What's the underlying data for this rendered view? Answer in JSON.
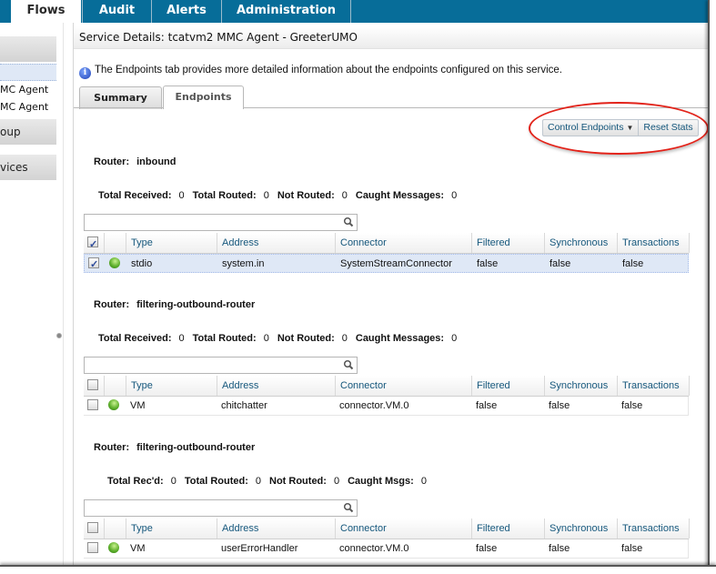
{
  "top_nav": {
    "tabs": [
      {
        "label": "Flows",
        "active": true
      },
      {
        "label": "Audit",
        "active": false
      },
      {
        "label": "Alerts",
        "active": false
      },
      {
        "label": "Administration",
        "active": false
      }
    ],
    "brand_color": "#076d99"
  },
  "sidebar": {
    "items": [
      {
        "label": "",
        "kind": "header"
      },
      {
        "label": "",
        "kind": "selected"
      },
      {
        "label": "MC Agent",
        "kind": "item"
      },
      {
        "label": "MC Agent",
        "kind": "item"
      },
      {
        "label": "oup",
        "kind": "header"
      },
      {
        "label": "vices",
        "kind": "header"
      }
    ]
  },
  "main": {
    "title": "Service Details: tcatvm2 MMC Agent - GreeterUMO",
    "info_text": "The Endpoints tab provides more detailed information about the endpoints configured on this service.",
    "tabs": [
      {
        "label": "Summary",
        "active": false
      },
      {
        "label": "Endpoints",
        "active": true
      }
    ],
    "actions": {
      "control_endpoints": "Control Endpoints",
      "reset_stats": "Reset Stats"
    },
    "annotation_color": "#e2231a",
    "columns": [
      "Type",
      "Address",
      "Connector",
      "Filtered",
      "Synchronous",
      "Transactions"
    ],
    "routers": [
      {
        "label": "Router:",
        "name": "inbound",
        "stats": [
          {
            "label": "Total Received:",
            "value": "0"
          },
          {
            "label": "Total Routed:",
            "value": "0"
          },
          {
            "label": "Not Routed:",
            "value": "0"
          },
          {
            "label": "Caught Messages:",
            "value": "0"
          }
        ],
        "search_value": "",
        "header_checked": true,
        "rows": [
          {
            "checked": true,
            "selected": true,
            "status": "running",
            "type": "stdio",
            "address": "system.in",
            "connector": "SystemStreamConnector",
            "filtered": "false",
            "synchronous": "false",
            "transactions": "false"
          }
        ]
      },
      {
        "label": "Router:",
        "name": "filtering-outbound-router",
        "stats": [
          {
            "label": "Total Received:",
            "value": "0"
          },
          {
            "label": "Total Routed:",
            "value": "0"
          },
          {
            "label": "Not Routed:",
            "value": "0"
          },
          {
            "label": "Caught Messages:",
            "value": "0"
          }
        ],
        "search_value": "",
        "header_checked": false,
        "rows": [
          {
            "checked": false,
            "selected": false,
            "status": "running",
            "type": "VM",
            "address": "chitchatter",
            "connector": "connector.VM.0",
            "filtered": "false",
            "synchronous": "false",
            "transactions": "false"
          }
        ]
      },
      {
        "label": "Router:",
        "name": "filtering-outbound-router",
        "stats": [
          {
            "label": "Total Rec'd:",
            "value": "0"
          },
          {
            "label": "Total Routed:",
            "value": "0"
          },
          {
            "label": "Not Routed:",
            "value": "0"
          },
          {
            "label": "Caught Msgs:",
            "value": "0"
          }
        ],
        "search_value": "",
        "header_checked": false,
        "rows": [
          {
            "checked": false,
            "selected": false,
            "status": "running",
            "type": "VM",
            "address": "userErrorHandler",
            "connector": "connector.VM.0",
            "filtered": "false",
            "synchronous": "false",
            "transactions": "false"
          }
        ]
      }
    ]
  }
}
